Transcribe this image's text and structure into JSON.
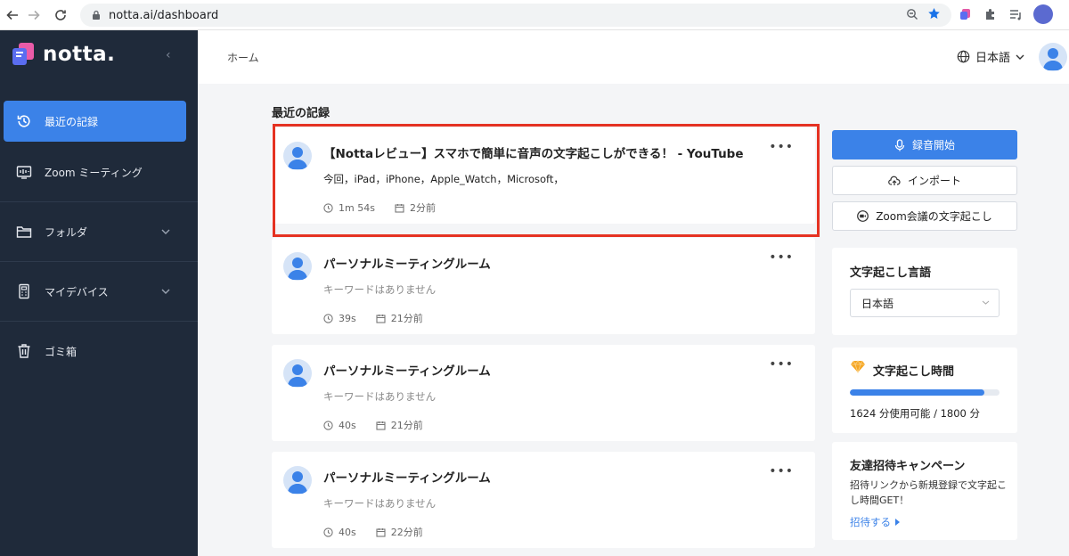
{
  "browser": {
    "url": "notta.ai/dashboard"
  },
  "sidebar": {
    "logo": "notta.",
    "items": [
      {
        "label": "最近の記録",
        "icon": "history-icon",
        "active": true
      },
      {
        "label": "Zoom ミーティング",
        "icon": "zoom-meeting-icon"
      },
      {
        "label": "フォルダ",
        "icon": "folder-icon",
        "expandable": true
      },
      {
        "label": "マイデバイス",
        "icon": "device-icon",
        "expandable": true
      },
      {
        "label": "ゴミ箱",
        "icon": "trash-icon"
      }
    ]
  },
  "header": {
    "breadcrumb": "ホーム",
    "language": "日本語"
  },
  "main": {
    "section_title": "最近の記録",
    "records": [
      {
        "title": "【Nottaレビュー】スマホで簡単に音声の文字起こしができる！ - YouTube",
        "keywords": "今回，iPad，iPhone，Apple_Watch，Microsoft，",
        "duration": "1m 54s",
        "time": "2分前"
      },
      {
        "title": "パーソナルミーティングルーム",
        "keywords": "キーワードはありません",
        "duration": "39s",
        "time": "21分前"
      },
      {
        "title": "パーソナルミーティングルーム",
        "keywords": "キーワードはありません",
        "duration": "40s",
        "time": "21分前"
      },
      {
        "title": "パーソナルミーティングルーム",
        "keywords": "キーワードはありません",
        "duration": "40s",
        "time": "22分前"
      }
    ]
  },
  "actions": {
    "record": "録音開始",
    "import": "インポート",
    "zoom": "Zoom会議の文字起こし"
  },
  "transcription_language": {
    "title": "文字起こし言語",
    "selected": "日本語"
  },
  "transcription_time": {
    "title": "文字起こし時間",
    "usage": "1624 分使用可能 / 1800 分",
    "progress_fraction": 0.9
  },
  "campaign": {
    "title": "友達招待キャンペーン",
    "text": "招待リンクから新規登録で文字起こし時間GET！",
    "link": "招待する"
  },
  "colors": {
    "sidebar_bg": "#1f2a3a",
    "accent": "#3b82e8",
    "highlight": "#e53222"
  }
}
